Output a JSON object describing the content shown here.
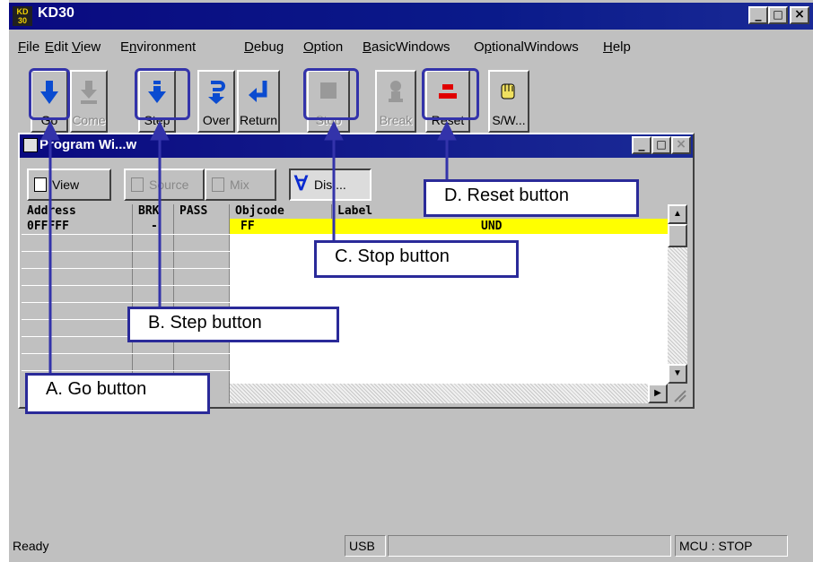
{
  "app": {
    "title": "KD30",
    "logo_top": "KD",
    "logo_bottom": "30"
  },
  "window_controls": {
    "minimize": "_",
    "maximize": "□",
    "close": "×"
  },
  "menu": [
    {
      "label": "File",
      "u": "F",
      "rest": "ile"
    },
    {
      "label": "Edit",
      "u": "E",
      "rest": "dit"
    },
    {
      "label": "View",
      "u": "V",
      "rest": "iew"
    },
    {
      "label": "Environment",
      "pre": "E",
      "u": "n",
      "rest": "vironment"
    },
    {
      "label": "Debug",
      "u": "D",
      "rest": "ebug"
    },
    {
      "label": "Option",
      "u": "O",
      "rest": "ption"
    },
    {
      "label": "BasicWindows",
      "u": "B",
      "rest": "asicWindows"
    },
    {
      "label": "OptionalWindows",
      "pre": "O",
      "u": "p",
      "rest": "tionalWindows"
    },
    {
      "label": "Help",
      "u": "H",
      "rest": "elp"
    }
  ],
  "toolbar": {
    "go": "Go",
    "come": "Come",
    "step": "Step",
    "over": "Over",
    "return": "Return",
    "stop": "Stop",
    "break": "Break",
    "reset": "Reset",
    "sw": "S/W..."
  },
  "program_window": {
    "title": "Program Wi...w",
    "view_btn": "View",
    "source_btn": "Source",
    "mix_btn": "Mix",
    "dis_btn": "Dis ...",
    "columns": [
      "Address",
      "BRK",
      "PASS",
      "Objcode",
      "Label"
    ],
    "row": {
      "address": "0FFFFF",
      "brk": "-",
      "objcode": "FF",
      "mnemonic": "UND"
    }
  },
  "callouts": {
    "a": "A. Go button",
    "b": "B. Step button",
    "c": "C. Stop button",
    "d": "D. Reset button"
  },
  "status": {
    "ready": "Ready",
    "usb": "USB",
    "mcu": "MCU : STOP"
  },
  "colors": {
    "titlebar": "#0a0a80",
    "callout_border": "#2a2a99",
    "highlight_row": "#ffff00",
    "face": "#c0c0c0"
  }
}
